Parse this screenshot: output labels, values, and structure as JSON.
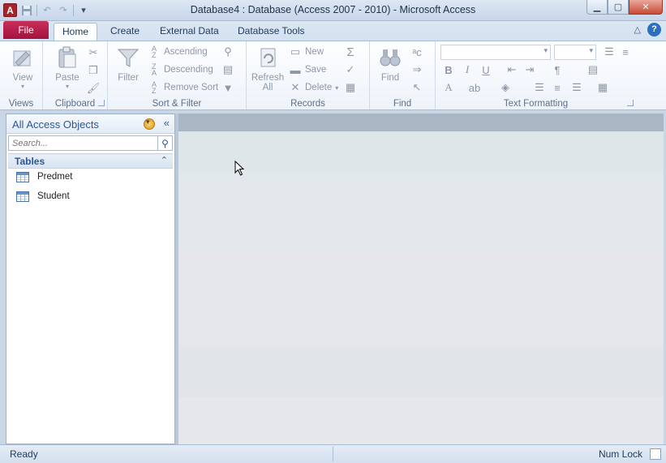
{
  "window": {
    "title": "Database4 : Database (Access 2007 - 2010)  -  Microsoft Access",
    "app_letter": "A"
  },
  "tabs": {
    "file": "File",
    "home": "Home",
    "create": "Create",
    "external": "External Data",
    "tools": "Database Tools"
  },
  "ribbon": {
    "views": {
      "view": "View",
      "label": "Views"
    },
    "clipboard": {
      "paste": "Paste",
      "label": "Clipboard"
    },
    "sort_filter": {
      "filter": "Filter",
      "ascending": "Ascending",
      "descending": "Descending",
      "remove_sort": "Remove Sort",
      "label": "Sort & Filter"
    },
    "records": {
      "refresh": "Refresh",
      "refresh_all": "All",
      "new": "New",
      "save": "Save",
      "delete": "Delete",
      "label": "Records"
    },
    "find": {
      "find": "Find",
      "label": "Find"
    },
    "text_formatting": {
      "label": "Text Formatting"
    }
  },
  "nav": {
    "title": "All Access Objects",
    "search_placeholder": "Search...",
    "group": "Tables",
    "items": [
      "Predmet",
      "Student"
    ]
  },
  "status": {
    "left": "Ready",
    "right": "Num Lock"
  }
}
